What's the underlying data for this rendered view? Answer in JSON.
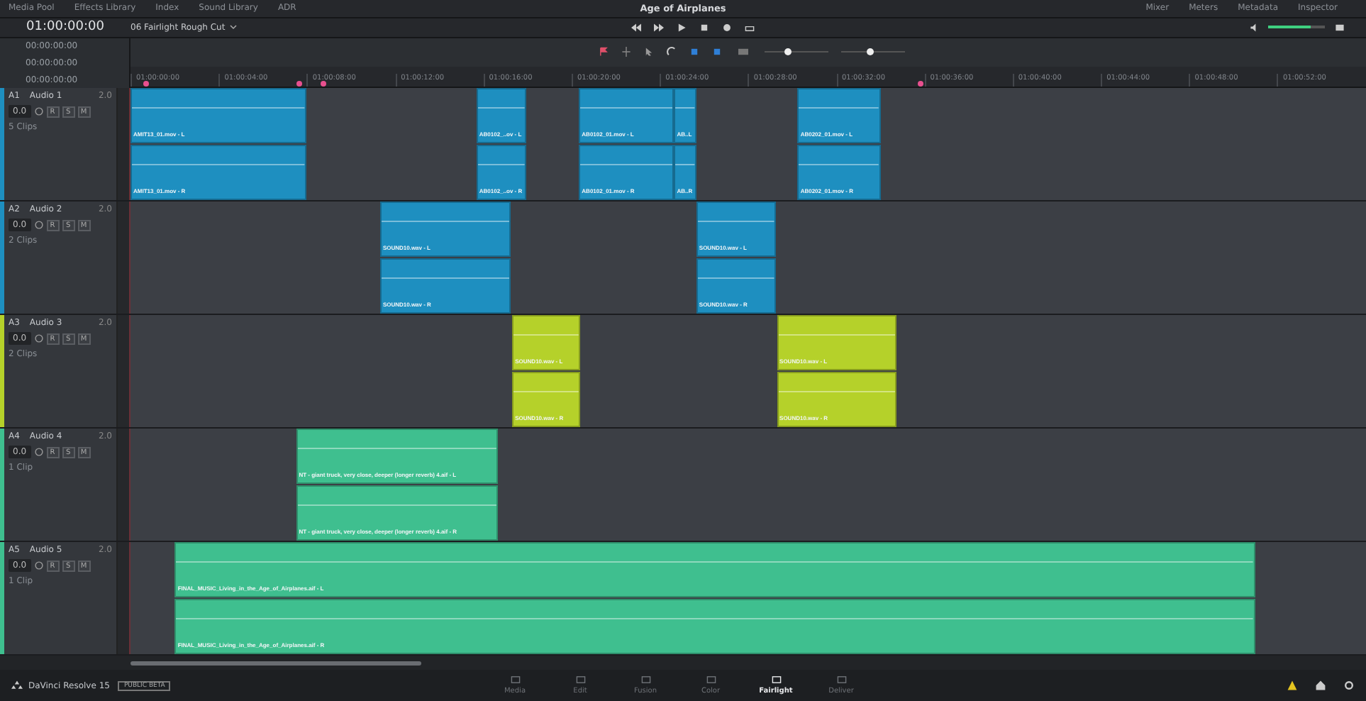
{
  "menu": {
    "left": [
      "Media Pool",
      "Effects Library",
      "Index",
      "Sound Library",
      "ADR"
    ],
    "title": "Age of Airplanes",
    "right": [
      "Mixer",
      "Meters",
      "Metadata",
      "Inspector"
    ]
  },
  "transport": {
    "timecode": "01:00:00:00",
    "timeline": "06 Fairlight Rough Cut",
    "volume": {
      "level": 0.75
    }
  },
  "timecodes": [
    "00:00:00:00",
    "00:00:00:00",
    "00:00:00:00"
  ],
  "toolbar": {
    "zoom_sliders": [
      {
        "level": 0.3
      },
      {
        "level": 0.4
      }
    ]
  },
  "ruler": [
    "01:00:00:00",
    "01:00:04:00",
    "01:00:08:00",
    "01:00:12:00",
    "01:00:16:00",
    "01:00:20:00",
    "01:00:24:00",
    "01:00:28:00",
    "01:00:32:00",
    "01:00:36:00",
    "01:00:40:00",
    "01:00:44:00",
    "01:00:48:00",
    "01:00:52:00"
  ],
  "tracks": [
    {
      "id": "A1",
      "name": "Audio 1",
      "format": "2.0",
      "gain": "0.0",
      "clips_count": "5 Clips",
      "buttons": [
        "R",
        "S",
        "M"
      ],
      "color": "#1e8fc0",
      "clips": [
        [
          "AMIT13_01.mov - L",
          "AMIT13_01.mov - R"
        ],
        [
          "AB0102_..ov - L",
          "AB0102_..ov - R"
        ],
        [
          "AB0102_01.mov - L",
          "AB0102_01.mov - R"
        ],
        [
          "AB..L",
          "AB..R"
        ],
        [
          "AB0202_01.mov - L",
          "AB0202_01.mov - R"
        ]
      ]
    },
    {
      "id": "A2",
      "name": "Audio 2",
      "format": "2.0",
      "gain": "0.0",
      "clips_count": "2 Clips",
      "buttons": [
        "R",
        "S",
        "M"
      ],
      "color": "#1e8fc0",
      "clips": [
        [
          "SOUND10.wav - L",
          "SOUND10.wav - R"
        ],
        [
          "SOUND10.wav - L",
          "SOUND10.wav - R"
        ]
      ]
    },
    {
      "id": "A3",
      "name": "Audio 3",
      "format": "2.0",
      "gain": "0.0",
      "clips_count": "2 Clips",
      "buttons": [
        "R",
        "S",
        "M"
      ],
      "color": "#b5d12a",
      "clips": [
        [
          "SOUND10.wav - L",
          "SOUND10.wav - R"
        ],
        [
          "SOUND10.wav - L",
          "SOUND10.wav - R"
        ]
      ]
    },
    {
      "id": "A4",
      "name": "Audio 4",
      "format": "2.0",
      "gain": "0.0",
      "clips_count": "1 Clip",
      "buttons": [
        "R",
        "S",
        "M"
      ],
      "color": "#3fbf8f",
      "clips": [
        [
          "NT - giant truck, very close, deeper (longer reverb) 4.aif - L",
          "NT - giant truck, very close, deeper (longer reverb) 4.aif - R"
        ]
      ]
    },
    {
      "id": "A5",
      "name": "Audio 5",
      "format": "2.0",
      "gain": "0.0",
      "clips_count": "1 Clip",
      "buttons": [
        "R",
        "S",
        "M"
      ],
      "color": "#3fbf8f",
      "clips": [
        [
          "FINAL_MUSIC_Living_in_the_Age_of_Airplanes.aif - L",
          "FINAL_MUSIC_Living_in_the_Age_of_Airplanes.aif - R"
        ]
      ]
    }
  ],
  "app": {
    "name": "DaVinci Resolve 15",
    "badge": "PUBLIC BETA"
  },
  "pages": [
    {
      "label": "Media",
      "selected": false
    },
    {
      "label": "Edit",
      "selected": false
    },
    {
      "label": "Fusion",
      "selected": false
    },
    {
      "label": "Color",
      "selected": false
    },
    {
      "label": "Fairlight",
      "selected": true
    },
    {
      "label": "Deliver",
      "selected": false
    }
  ]
}
